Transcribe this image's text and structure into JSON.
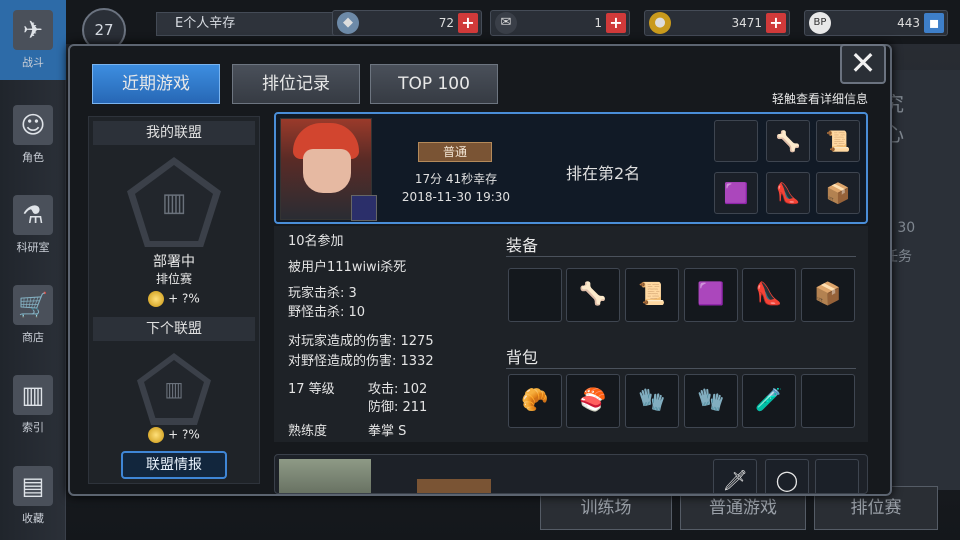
{
  "nav": {
    "items": [
      {
        "label": "战斗",
        "icon": "crossed-guns-icon",
        "glyph": "✈"
      },
      {
        "label": "角色",
        "icon": "character-icon",
        "glyph": "☺"
      },
      {
        "label": "科研室",
        "icon": "flask-icon",
        "glyph": "⚗"
      },
      {
        "label": "商店",
        "icon": "cart-icon",
        "glyph": "🛒"
      },
      {
        "label": "索引",
        "icon": "books-icon",
        "glyph": "▥"
      },
      {
        "label": "收藏",
        "icon": "book-open-icon",
        "glyph": "▤"
      }
    ]
  },
  "topbar": {
    "level": "27",
    "player_name": "E个人辛存",
    "resources": [
      {
        "icon": "crystal-icon",
        "value": "72"
      },
      {
        "icon": "ticket-icon",
        "value": "1"
      },
      {
        "icon": "gold-coin-icon",
        "value": "3471"
      },
      {
        "icon": "bp-badge-icon",
        "value": "443"
      }
    ]
  },
  "background": {
    "buttons": [
      "训练场",
      "普通游戏",
      "排位赛"
    ],
    "side_text": [
      "究",
      "心",
      "7 30",
      "任务"
    ]
  },
  "modal": {
    "tabs": [
      "近期游戏",
      "排位记录",
      "TOP 100"
    ],
    "active_tab": 0,
    "hint": "轻触查看详细信息",
    "close_glyph": "✕",
    "alliance": {
      "my_title": "我的联盟",
      "status": "部署中",
      "mode": "排位赛",
      "bonus": "+ ?%",
      "next_title": "下个联盟",
      "next_bonus": "+ ?%",
      "info_button": "联盟情报"
    },
    "game": {
      "mode": "普通",
      "survival": "17分 41秒幸存",
      "datetime": "2018-11-30 19:30",
      "rank": "排在第2名",
      "players": "10名参加",
      "killed_by": "被用户111wiwi杀死",
      "player_kills": "玩家击杀: 3",
      "monster_kills": "野怪击杀: 10",
      "player_damage": "对玩家造成的伤害: 1275",
      "monster_damage": "对野怪造成的伤害: 1332",
      "level": "17 等级",
      "attack": "攻击: 102",
      "defense": "防御: 211",
      "proficiency_label": "熟练度",
      "proficiency_value": "拳掌 S",
      "equipment_title": "装备",
      "bag_title": "背包",
      "card_slots": [
        "",
        "🦴",
        "📜",
        "🟪",
        "👠",
        "📦"
      ],
      "equipment": [
        "",
        "🦴",
        "📜",
        "🟪",
        "👠",
        "📦"
      ],
      "bag": [
        "🥐",
        "🍣",
        "🧤",
        "🧤",
        "🧪",
        ""
      ]
    },
    "game2": {
      "slots": [
        "🗡",
        "◯",
        ""
      ]
    }
  },
  "colors": {
    "accent": "#2767b5",
    "card_border": "#4a8ed8",
    "badge": "#7a5434",
    "plus_red": "#d03a3a"
  }
}
